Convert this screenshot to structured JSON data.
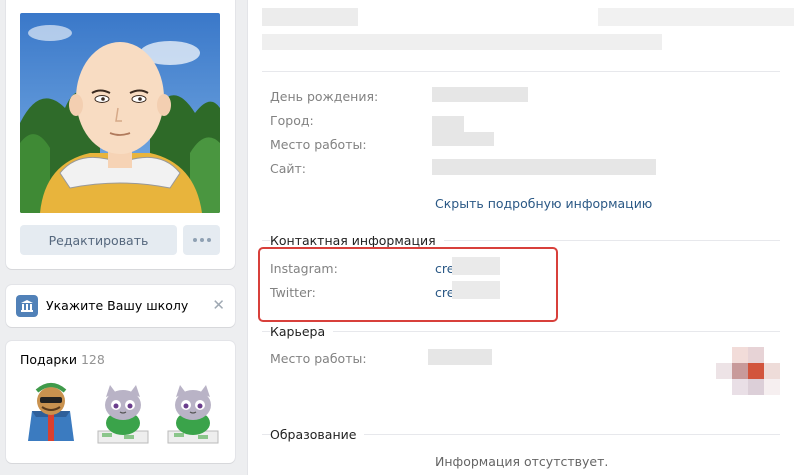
{
  "profile": {
    "edit_button": "Редактировать"
  },
  "school": {
    "label": "Укажите Вашу школу",
    "close_glyph": "✕"
  },
  "gifts": {
    "title": "Подарки",
    "count": "128"
  },
  "details": {
    "birthday_label": "День рождения:",
    "city_label": "Город:",
    "work_label": "Место работы:",
    "site_label": "Сайт:",
    "hide_link": "Скрыть подробную информацию"
  },
  "contacts": {
    "title": "Контактная информация",
    "instagram_label": "Instagram:",
    "instagram_value": "cre",
    "twitter_label": "Twitter:",
    "twitter_value": "cre"
  },
  "career": {
    "title": "Карьера",
    "work_label": "Место работы:"
  },
  "education": {
    "title": "Образование",
    "empty_text": "Информация отсутствует."
  },
  "colors": {
    "accent_link": "#2a5885",
    "highlight": "#d8403b",
    "button_bg": "#e5ebf1"
  }
}
